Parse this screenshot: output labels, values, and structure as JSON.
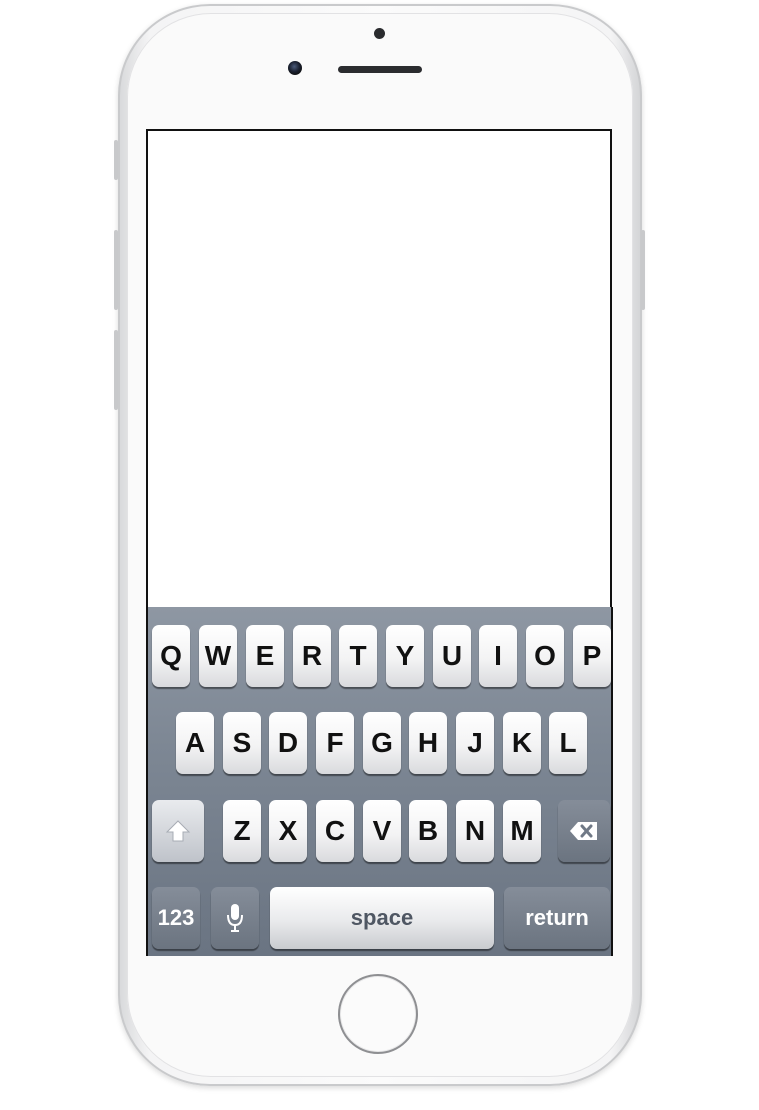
{
  "keyboard": {
    "row1": [
      "Q",
      "W",
      "E",
      "R",
      "T",
      "Y",
      "U",
      "I",
      "O",
      "P"
    ],
    "row2": [
      "A",
      "S",
      "D",
      "F",
      "G",
      "H",
      "J",
      "K",
      "L"
    ],
    "row3": [
      "Z",
      "X",
      "C",
      "V",
      "B",
      "N",
      "M"
    ],
    "numbers_label": "123",
    "space_label": "space",
    "return_label": "return"
  },
  "icons": {
    "shift": "shift-icon",
    "delete": "backspace-icon",
    "mic": "microphone-icon"
  }
}
